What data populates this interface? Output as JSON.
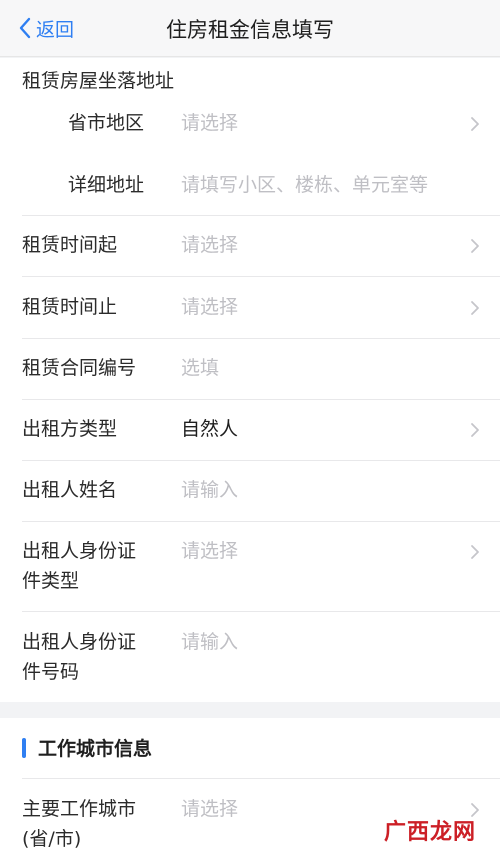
{
  "nav": {
    "back_label": "返回",
    "title": "住房租金信息填写"
  },
  "address_section": {
    "title": "租赁房屋坐落地址",
    "region": {
      "label": "省市地区",
      "placeholder": "请选择"
    },
    "detail": {
      "label": "详细地址",
      "placeholder": "请填写小区、楼栋、单元室等"
    }
  },
  "fields": {
    "lease_start": {
      "label": "租赁时间起",
      "placeholder": "请选择"
    },
    "lease_end": {
      "label": "租赁时间止",
      "placeholder": "请选择"
    },
    "contract_no": {
      "label": "租赁合同编号",
      "placeholder": "选填"
    },
    "lessor_type": {
      "label": "出租方类型",
      "value": "自然人"
    },
    "lessor_name": {
      "label": "出租人姓名",
      "placeholder": "请输入"
    },
    "lessor_id_type": {
      "label_line1": "出租人身份证",
      "label_line2": "件类型",
      "placeholder": "请选择"
    },
    "lessor_id_no": {
      "label_line1": "出租人身份证",
      "label_line2": "件号码",
      "placeholder": "请输入"
    }
  },
  "work_city_section": {
    "title": "工作城市信息",
    "main_city": {
      "label_line1": "主要工作城市",
      "label_line2": "(省/市)",
      "placeholder": "请选择"
    }
  },
  "watermark": "广西龙网",
  "colors": {
    "accent": "#2f7ff2",
    "placeholder": "#bfbfc4",
    "text": "#1f1f1f"
  }
}
